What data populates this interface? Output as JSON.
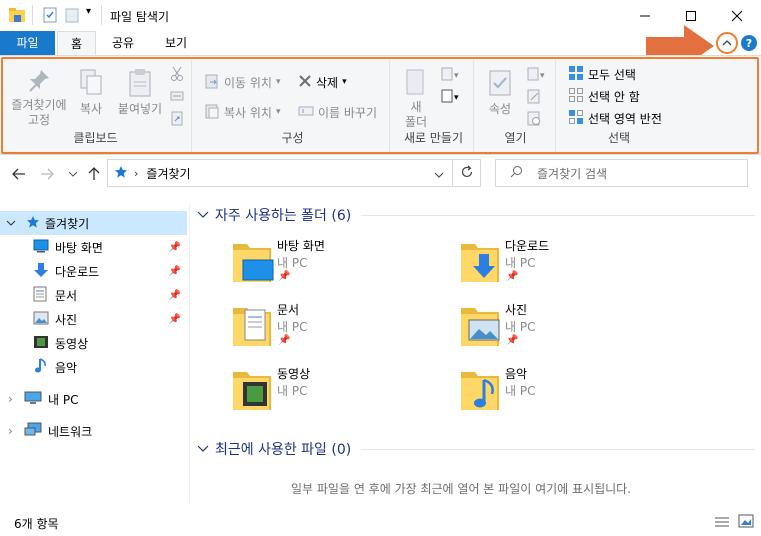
{
  "window": {
    "title": "파일 탐색기"
  },
  "ribbon_tabs": {
    "file": "파일",
    "home": "홈",
    "share": "공유",
    "view": "보기"
  },
  "ribbon": {
    "clipboard": {
      "pin_line1": "즐겨찾기에",
      "pin_line2": "고정",
      "copy": "복사",
      "paste": "붙여넣기",
      "label": "클립보드"
    },
    "organize": {
      "move_to": "이동 위치",
      "copy_to": "복사 위치",
      "delete": "삭제",
      "rename": "이름 바꾸기",
      "label": "구성"
    },
    "new": {
      "new_folder_line1": "새",
      "new_folder_line2": "폴더",
      "label": "새로 만들기"
    },
    "open": {
      "properties": "속성",
      "label": "열기"
    },
    "select": {
      "select_all": "모두 선택",
      "select_none": "선택 안 함",
      "invert": "선택 영역 반전",
      "label": "선택"
    },
    "accent": "#ed7d31"
  },
  "address": {
    "path": "즐겨찾기",
    "search_placeholder": "즐겨찾기 검색"
  },
  "navpane": {
    "quick_access": "즐겨찾기",
    "items": [
      {
        "label": "바탕 화면",
        "icon": "desktop-icon"
      },
      {
        "label": "다운로드",
        "icon": "download-icon"
      },
      {
        "label": "문서",
        "icon": "document-icon"
      },
      {
        "label": "사진",
        "icon": "picture-icon"
      },
      {
        "label": "동영상",
        "icon": "video-icon"
      },
      {
        "label": "음악",
        "icon": "music-icon"
      }
    ],
    "this_pc": "내 PC",
    "network": "네트워크"
  },
  "content": {
    "frequent_header": "자주 사용하는 폴더 (6)",
    "recent_header": "최근에 사용한 파일 (0)",
    "recent_empty": "일부 파일을 연 후에 가장 최근에 열어 본 파일이 여기에 표시됩니다.",
    "folders": [
      {
        "name": "바탕 화면",
        "location": "내 PC"
      },
      {
        "name": "다운로드",
        "location": "내 PC"
      },
      {
        "name": "문서",
        "location": "내 PC"
      },
      {
        "name": "사진",
        "location": "내 PC"
      },
      {
        "name": "동영상",
        "location": "내 PC"
      },
      {
        "name": "음악",
        "location": "내 PC"
      }
    ]
  },
  "status": {
    "item_count": "6개 항목"
  }
}
